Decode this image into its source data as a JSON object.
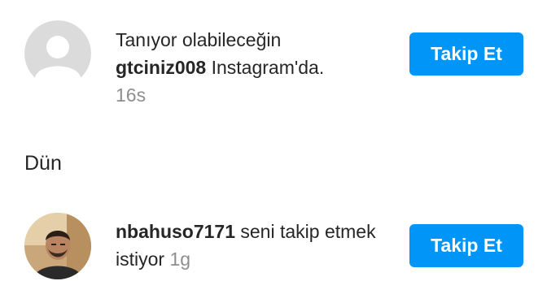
{
  "notifications": [
    {
      "line1": "Tanıyor olabileceğin",
      "username": "gtciniz008",
      "suffix": " Instagram'da.",
      "time": "16s",
      "button_label": "Takip Et",
      "avatar_icon": "default-avatar-icon"
    },
    {
      "username": "nbahuso7171",
      "suffix": " seni takip etmek istiyor",
      "time": " 1g",
      "button_label": "Takip Et",
      "avatar_icon": "user-photo-avatar"
    }
  ],
  "section": {
    "header": "Dün"
  },
  "colors": {
    "accent": "#0095f6",
    "secondary_text": "#8e8e8e",
    "primary_text": "#262626",
    "avatar_placeholder": "#dbdbdb"
  }
}
